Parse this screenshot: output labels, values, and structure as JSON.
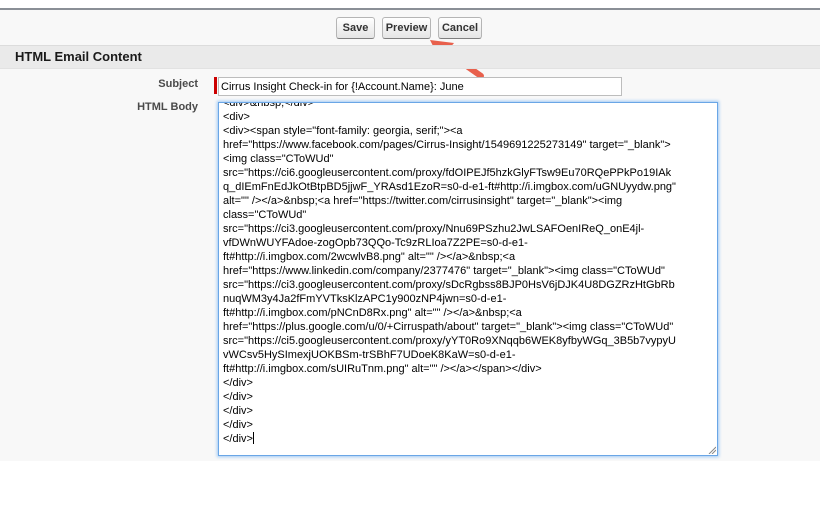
{
  "toolbar": {
    "save_label": "Save",
    "preview_label": "Preview",
    "cancel_label": "Cancel"
  },
  "section": {
    "title": "HTML Email Content"
  },
  "form": {
    "subject_label": "Subject",
    "subject_value": "Cirrus Insight Check-in for {!Account.Name}: June",
    "body_label": "HTML Body",
    "body_lines": [
      "<div>&nbsp;</div>",
      "<div>",
      "<div><span style=\"font-family: georgia, serif;\"><a",
      "href=\"https://www.facebook.com/pages/Cirrus-Insight/1549691225273149\" target=\"_blank\">",
      "<img class=\"CToWUd\"",
      "src=\"https://ci6.googleusercontent.com/proxy/fdOIPEJf5hzkGlyFTsw9Eu70RQePPkPo19IAk",
      "q_dIEmFnEdJkOtBtpBD5jjwF_YRAsd1EzoR=s0-d-e1-ft#http://i.imgbox.com/uGNUyydw.png\"",
      "alt=\"\" /></a>&nbsp;<a href=\"https://twitter.com/cirrusinsight\" target=\"_blank\"><img",
      "class=\"CToWUd\"",
      "src=\"https://ci3.googleusercontent.com/proxy/Nnu69PSzhu2JwLSAFOenIReQ_onE4jl-",
      "vfDWnWUYFAdoe-zogOpb73QQo-Tc9zRLIoa7Z2PE=s0-d-e1-",
      "ft#http://i.imgbox.com/2wcwlvB8.png\" alt=\"\" /></a>&nbsp;<a",
      "href=\"https://www.linkedin.com/company/2377476\" target=\"_blank\"><img class=\"CToWUd\"",
      "src=\"https://ci3.googleusercontent.com/proxy/sDcRgbss8BJP0HsV6jDJK4U8DGZRzHtGbRb",
      "nuqWM3y4Ja2fFmYVTksKlzAPC1y900zNP4jwn=s0-d-e1-",
      "ft#http://i.imgbox.com/pNCnD8Rx.png\" alt=\"\" /></a>&nbsp;<a",
      "href=\"https://plus.google.com/u/0/+Cirruspath/about\" target=\"_blank\"><img class=\"CToWUd\"",
      "src=\"https://ci5.googleusercontent.com/proxy/yYT0Ro9XNqqb6WEK8yfbyWGq_3B5b7vypyU",
      "vWCsv5HySImexjUOKBSm-trSBhF7UDoeK8KaW=s0-d-e1-",
      "ft#http://i.imgbox.com/sUIRuTnm.png\" alt=\"\" /></a></span></div>",
      "</div>",
      "</div>",
      "</div>",
      "</div>",
      "</div>"
    ]
  },
  "annotation": {
    "arrow_color": "#e8604c"
  }
}
